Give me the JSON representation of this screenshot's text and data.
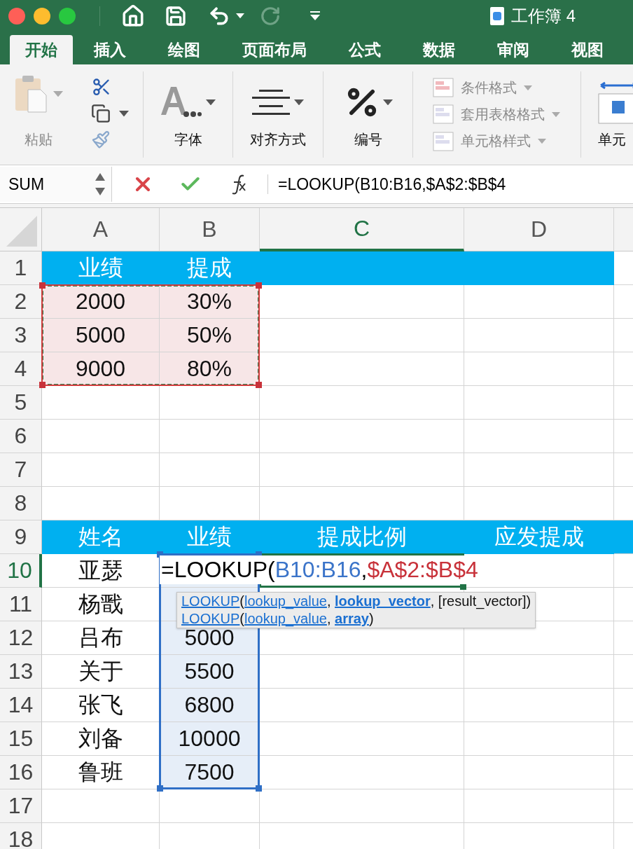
{
  "window": {
    "title": "工作簿 4"
  },
  "tabs": [
    {
      "label": "开始",
      "selected": true
    },
    {
      "label": "插入",
      "selected": false
    },
    {
      "label": "绘图",
      "selected": false
    },
    {
      "label": "页面布局",
      "selected": false
    },
    {
      "label": "公式",
      "selected": false
    },
    {
      "label": "数据",
      "selected": false
    },
    {
      "label": "审阅",
      "selected": false
    },
    {
      "label": "视图",
      "selected": false
    }
  ],
  "ribbon": {
    "groups": [
      {
        "kind": "clipboard",
        "label": "粘贴",
        "disabled": true
      },
      {
        "kind": "font",
        "label": "字体",
        "disabled": false
      },
      {
        "kind": "align",
        "label": "对齐方式",
        "disabled": false
      },
      {
        "kind": "number",
        "label": "编号",
        "disabled": false
      },
      {
        "kind": "styles",
        "items": [
          {
            "label": "条件格式",
            "disabled": true
          },
          {
            "label": "套用表格格式",
            "disabled": true
          },
          {
            "label": "单元格样式",
            "disabled": true
          }
        ]
      },
      {
        "kind": "cells",
        "label": "单元",
        "disabled": false
      }
    ]
  },
  "formula_bar": {
    "name_box": "SUM",
    "formula": "=LOOKUP(B10:B16,$A$2:$B$4"
  },
  "sheet": {
    "columns": [
      {
        "label": "A",
        "selected": false,
        "copied": true,
        "in_range": false
      },
      {
        "label": "B",
        "selected": false,
        "copied": true,
        "in_range": true
      },
      {
        "label": "C",
        "selected": true,
        "copied": false,
        "in_range": false
      },
      {
        "label": "D",
        "selected": false,
        "copied": false,
        "in_range": false
      }
    ],
    "rows": [
      {
        "number": "1",
        "selected": false,
        "copied": false,
        "in_range": false,
        "kind": "header",
        "cells": {
          "A": "业绩",
          "B": "提成"
        }
      },
      {
        "number": "2",
        "selected": false,
        "copied": true,
        "in_range": false,
        "kind": "data",
        "cells": {
          "A": "2000",
          "B": "30%"
        }
      },
      {
        "number": "3",
        "selected": false,
        "copied": true,
        "in_range": false,
        "kind": "data",
        "cells": {
          "A": "5000",
          "B": "50%"
        }
      },
      {
        "number": "4",
        "selected": false,
        "copied": true,
        "in_range": false,
        "kind": "data",
        "cells": {
          "A": "9000",
          "B": "80%"
        }
      },
      {
        "number": "5",
        "selected": false,
        "copied": false,
        "in_range": false,
        "kind": "data",
        "cells": {}
      },
      {
        "number": "6",
        "selected": false,
        "copied": false,
        "in_range": false,
        "kind": "data",
        "cells": {}
      },
      {
        "number": "7",
        "selected": false,
        "copied": false,
        "in_range": false,
        "kind": "data",
        "cells": {}
      },
      {
        "number": "8",
        "selected": false,
        "copied": false,
        "in_range": false,
        "kind": "data",
        "cells": {}
      },
      {
        "number": "9",
        "selected": false,
        "copied": false,
        "in_range": false,
        "kind": "header",
        "cells": {
          "A": "姓名",
          "B": "业绩",
          "C": "提成比例",
          "D": "应发提成"
        }
      },
      {
        "number": "10",
        "selected": true,
        "copied": false,
        "in_range": true,
        "kind": "data",
        "cells": {
          "A": "亚瑟",
          "B": {
            "parts": [
              {
                "text": "=LOOKUP(",
                "color": "#000000"
              },
              {
                "text": "B10:B16",
                "color": "#3b74c9"
              },
              {
                "text": ",",
                "color": "#000000"
              },
              {
                "text": "$A$2:$B$4",
                "color": "#c8323a"
              }
            ]
          }
        }
      },
      {
        "number": "11",
        "selected": false,
        "copied": false,
        "in_range": true,
        "kind": "data",
        "cells": {
          "A": "杨戬"
        }
      },
      {
        "number": "12",
        "selected": false,
        "copied": false,
        "in_range": true,
        "kind": "data",
        "cells": {
          "A": "吕布",
          "B": "5000"
        }
      },
      {
        "number": "13",
        "selected": false,
        "copied": false,
        "in_range": true,
        "kind": "data",
        "cells": {
          "A": "关于",
          "B": "5500"
        }
      },
      {
        "number": "14",
        "selected": false,
        "copied": false,
        "in_range": true,
        "kind": "data",
        "cells": {
          "A": "张飞",
          "B": "6800"
        }
      },
      {
        "number": "15",
        "selected": false,
        "copied": false,
        "in_range": true,
        "kind": "data",
        "cells": {
          "A": "刘备",
          "B": "10000"
        }
      },
      {
        "number": "16",
        "selected": false,
        "copied": false,
        "in_range": true,
        "kind": "data",
        "cells": {
          "A": "鲁班",
          "B": "7500"
        }
      },
      {
        "number": "17",
        "selected": false,
        "copied": false,
        "in_range": false,
        "kind": "data",
        "cells": {}
      },
      {
        "number": "18",
        "selected": false,
        "copied": false,
        "in_range": false,
        "kind": "data",
        "cells": {}
      }
    ]
  },
  "tooltip": {
    "lines": [
      [
        {
          "text": "LOOKUP",
          "kind": "link"
        },
        {
          "text": "(",
          "kind": "plain"
        },
        {
          "text": "lookup_value",
          "kind": "link"
        },
        {
          "text": ", ",
          "kind": "plain"
        },
        {
          "text": "lookup_vector",
          "kind": "current"
        },
        {
          "text": ", [result_vector])",
          "kind": "plain"
        }
      ],
      [
        {
          "text": "LOOKUP",
          "kind": "link"
        },
        {
          "text": "(",
          "kind": "plain"
        },
        {
          "text": "lookup_value",
          "kind": "link"
        },
        {
          "text": ", ",
          "kind": "plain"
        },
        {
          "text": "array",
          "kind": "current"
        },
        {
          "text": ")",
          "kind": "plain"
        }
      ]
    ]
  }
}
